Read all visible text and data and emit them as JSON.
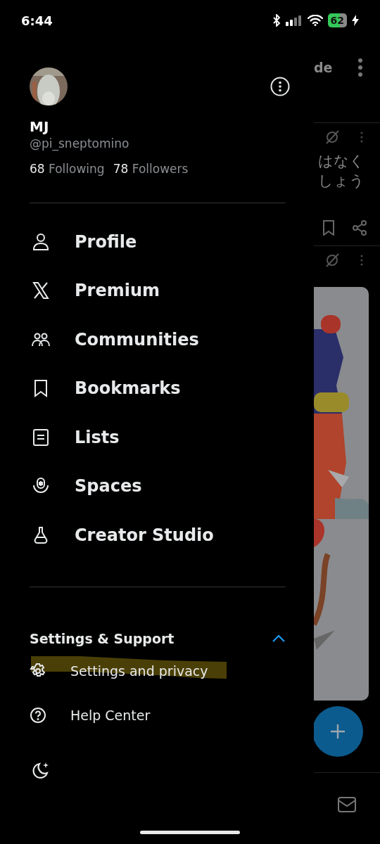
{
  "status_bar": {
    "time": "6:44",
    "battery": "62",
    "charging": true
  },
  "profile": {
    "name": "MJ",
    "handle": "@pi_sneptomino",
    "following_count": "68",
    "following_label": "Following",
    "followers_count": "78",
    "followers_label": "Followers"
  },
  "menu": [
    {
      "kind": "person",
      "label": "Profile"
    },
    {
      "kind": "x",
      "label": "Premium"
    },
    {
      "kind": "people",
      "label": "Communities"
    },
    {
      "kind": "bookmark",
      "label": "Bookmarks"
    },
    {
      "kind": "list",
      "label": "Lists"
    },
    {
      "kind": "spaces",
      "label": "Spaces"
    },
    {
      "kind": "flask",
      "label": "Creator Studio"
    }
  ],
  "settings_section": {
    "title": "Settings & Support",
    "expanded": true,
    "items": [
      {
        "kind": "gear",
        "label": "Settings and privacy",
        "highlighted": true
      },
      {
        "kind": "help",
        "label": "Help Center",
        "highlighted": false
      }
    ]
  },
  "feed_behind": {
    "header_text": "de",
    "post_lines": [
      "はなく",
      "しょう"
    ]
  }
}
